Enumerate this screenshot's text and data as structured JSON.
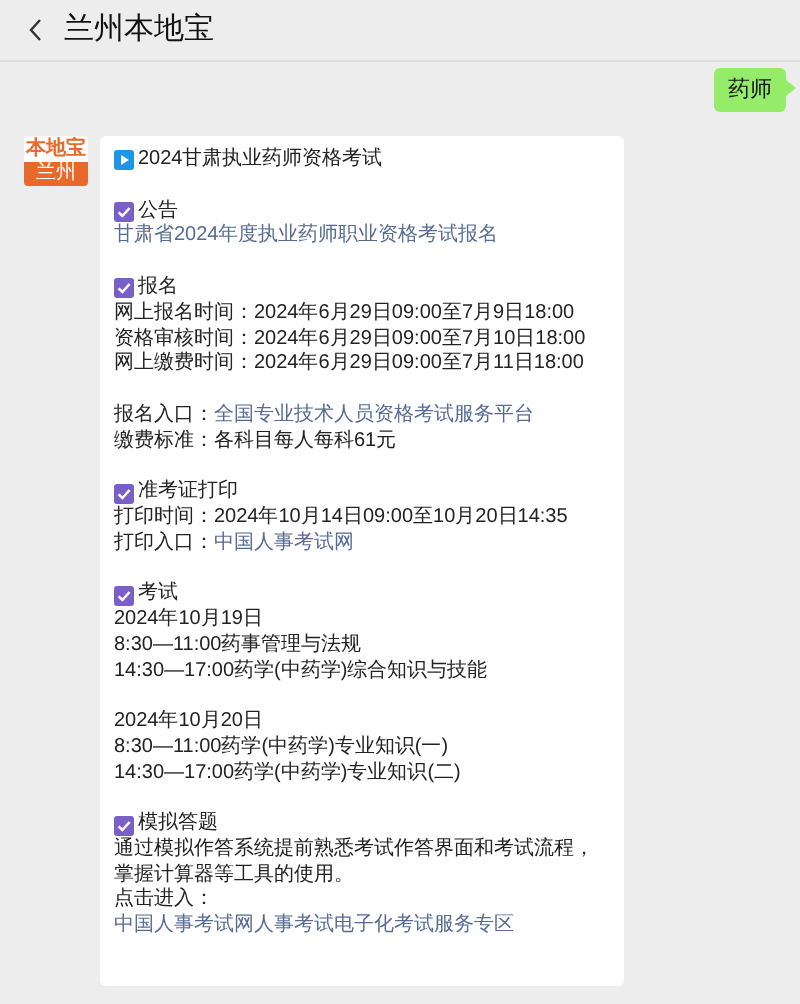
{
  "header": {
    "title": "兰州本地宝"
  },
  "messages": [
    {
      "kind": "outgoing",
      "text": "药师"
    },
    {
      "kind": "incoming",
      "avatar": {
        "brand": "本地宝",
        "city": "兰州"
      },
      "title": "2024甘肃执业药师资格考试",
      "sections": [
        {
          "heading": "公告",
          "paragraphs": [
            [
              {
                "kind": "link",
                "text": "甘肃省2024年度执业药师职业资格考试报名"
              }
            ]
          ]
        },
        {
          "heading": "报名",
          "paragraphs": [
            [
              {
                "kind": "text",
                "text": "网上报名时间：2024年6月29日09:00至7月9日18:00"
              },
              {
                "kind": "text",
                "text": "资格审核时间：2024年6月29日09:00至7月10日18:00"
              },
              {
                "kind": "text",
                "text": "网上缴费时间：2024年6月29日09:00至7月11日18:00"
              }
            ],
            [
              {
                "kind": "labeled_link",
                "label": "报名入口：",
                "text": "全国专业技术人员资格考试服务平台"
              },
              {
                "kind": "text",
                "text": "缴费标准：各科目每人每科61元"
              }
            ]
          ]
        },
        {
          "heading": "准考证打印",
          "paragraphs": [
            [
              {
                "kind": "text",
                "text": "打印时间：2024年10月14日09:00至10月20日14:35"
              },
              {
                "kind": "labeled_link",
                "label": "打印入口：",
                "text": "中国人事考试网"
              }
            ]
          ]
        },
        {
          "heading": "考试",
          "paragraphs": [
            [
              {
                "kind": "text",
                "text": "2024年10月19日"
              },
              {
                "kind": "text",
                "text": "8:30—11:00药事管理与法规"
              },
              {
                "kind": "text",
                "text": "14:30—17:00药学(中药学)综合知识与技能"
              }
            ],
            [
              {
                "kind": "text",
                "text": "2024年10月20日"
              },
              {
                "kind": "text",
                "text": "8:30—11:00药学(中药学)专业知识(一)"
              },
              {
                "kind": "text",
                "text": "14:30—17:00药学(中药学)专业知识(二)"
              }
            ]
          ]
        },
        {
          "heading": "模拟答题",
          "paragraphs": [
            [
              {
                "kind": "text",
                "text": "通过模拟作答系统提前熟悉考试作答界面和考试流程，掌握计算器等工具的使用。"
              },
              {
                "kind": "labeled_link",
                "label": "点击进入：",
                "text": "中国人事考试网人事考试电子化考试服务专区"
              }
            ]
          ]
        }
      ]
    }
  ]
}
